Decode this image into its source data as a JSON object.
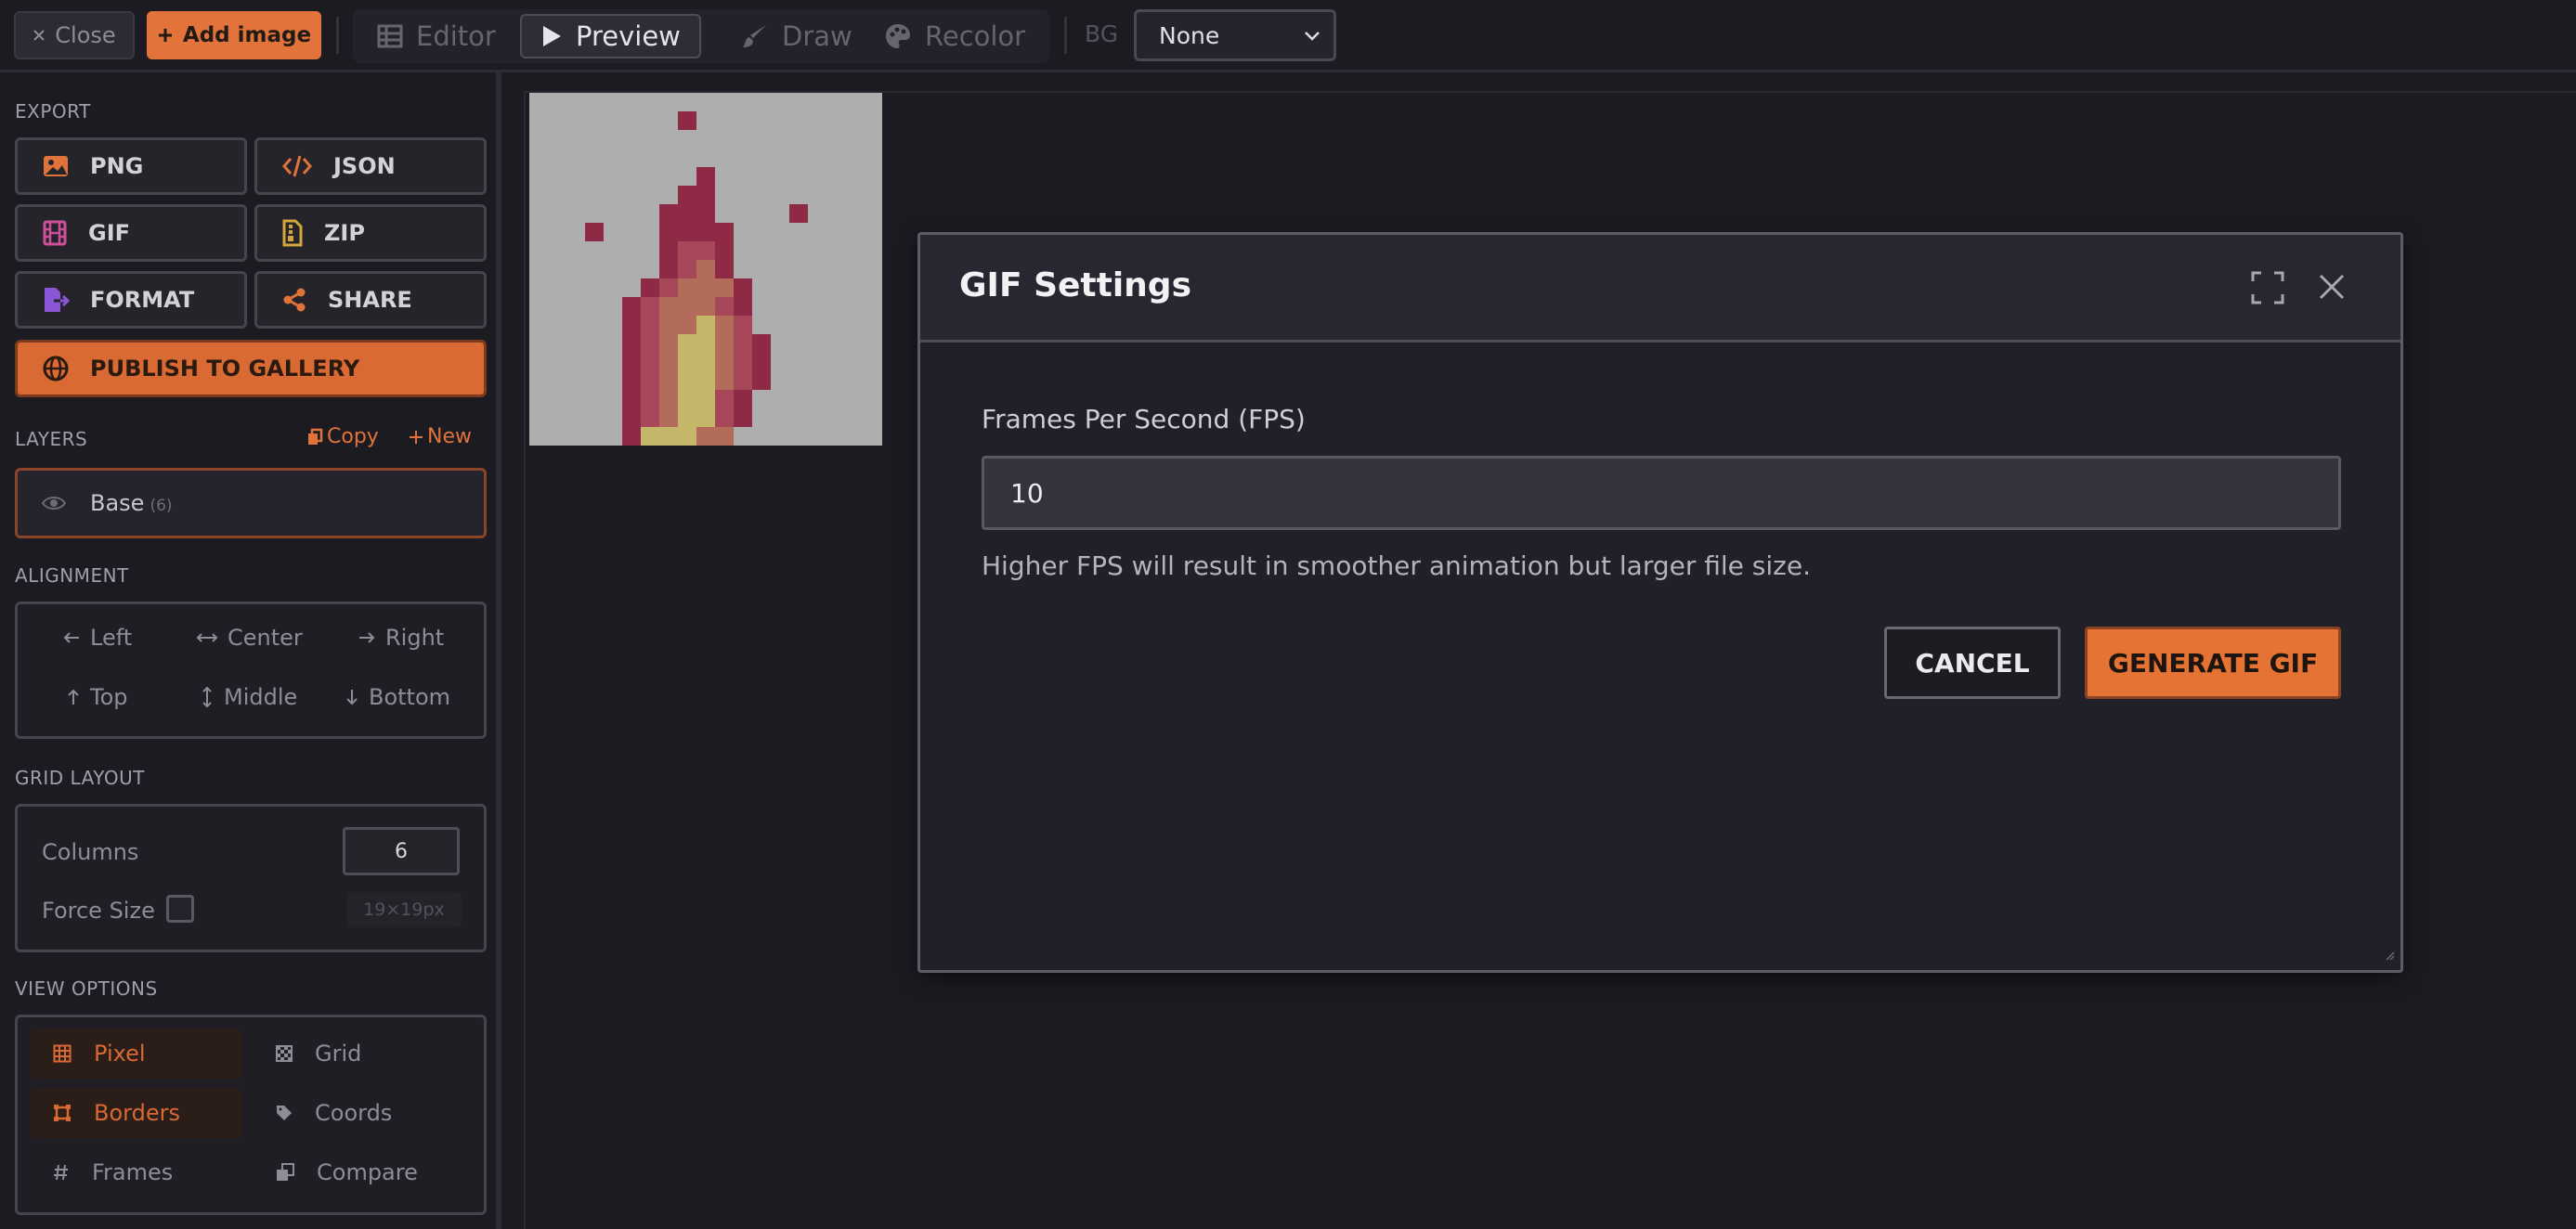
{
  "toolbar": {
    "close_label": "Close",
    "add_image_label": "Add image",
    "modes": [
      {
        "label": "Editor",
        "icon": "table-icon",
        "active": false
      },
      {
        "label": "Preview",
        "icon": "play-icon",
        "active": true
      },
      {
        "label": "Draw",
        "icon": "brush-icon",
        "active": false
      },
      {
        "label": "Recolor",
        "icon": "palette-icon",
        "active": false
      }
    ],
    "bg_label": "BG",
    "bg_value": "None"
  },
  "sidebar": {
    "export_title": "EXPORT",
    "export_buttons": [
      {
        "label": "PNG",
        "icon": "image-icon",
        "color": "#e0733a"
      },
      {
        "label": "JSON",
        "icon": "code-icon",
        "color": "#e0733a"
      },
      {
        "label": "GIF",
        "icon": "film-icon",
        "color": "#d04f9a"
      },
      {
        "label": "ZIP",
        "icon": "archive-icon",
        "color": "#d4a53a"
      },
      {
        "label": "FORMAT",
        "icon": "file-export-icon",
        "color": "#8a55d6"
      },
      {
        "label": "SHARE",
        "icon": "share-icon",
        "color": "#e0733a"
      }
    ],
    "publish_label": "PUBLISH TO GALLERY",
    "layers_title": "LAYERS",
    "copy_label": "Copy",
    "new_label": "New",
    "layer": {
      "name": "Base",
      "count": "(6)"
    },
    "alignment_title": "ALIGNMENT",
    "alignment": {
      "left": "Left",
      "center": "Center",
      "right": "Right",
      "top": "Top",
      "middle": "Middle",
      "bottom": "Bottom"
    },
    "grid_title": "GRID LAYOUT",
    "grid": {
      "columns_label": "Columns",
      "columns_value": "6",
      "force_size_label": "Force Size",
      "size_readout": "19×19px"
    },
    "view_title": "VIEW OPTIONS",
    "view_options": [
      {
        "label": "Pixel",
        "icon": "grid-icon",
        "on": true
      },
      {
        "label": "Grid",
        "icon": "checker-icon",
        "on": false
      },
      {
        "label": "Borders",
        "icon": "frame-icon",
        "on": true
      },
      {
        "label": "Coords",
        "icon": "tag-icon",
        "on": false
      },
      {
        "label": "Frames",
        "icon": "hash-icon",
        "on": false
      },
      {
        "label": "Compare",
        "icon": "copy-icon",
        "on": false
      }
    ]
  },
  "modal": {
    "title": "GIF Settings",
    "fps_label": "Frames Per Second (FPS)",
    "fps_value": "10",
    "help_text": "Higher FPS will result in smoother animation but larger file size.",
    "cancel_label": "CANCEL",
    "generate_label": "GENERATE GIF"
  },
  "colors": {
    "accent": "#e57333",
    "background": "#1c1b22",
    "modal_bg": "#211f28",
    "flame_dark": "#8e2a45",
    "flame_mid": "#a6475a",
    "flame_orange": "#b36c5a",
    "flame_light": "#c5b76a",
    "sprite_bg": "#aeaeae"
  }
}
